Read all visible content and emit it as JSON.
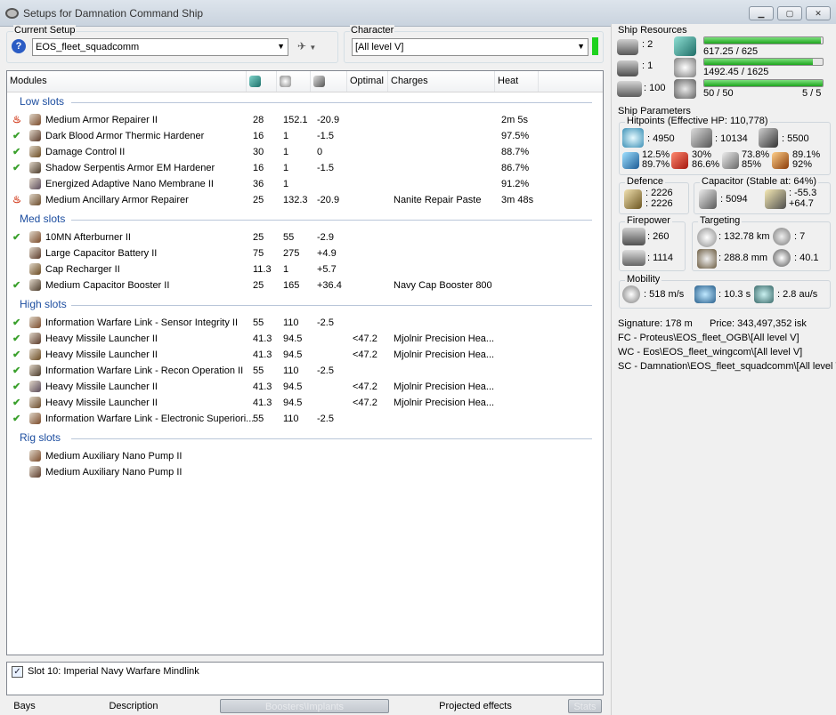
{
  "window": {
    "title": "Setups for Damnation Command Ship"
  },
  "setup": {
    "label": "Current Setup",
    "value": "EOS_fleet_squadcomm"
  },
  "character": {
    "label": "Character",
    "value": "[All level V]"
  },
  "columns": {
    "modules": "Modules",
    "optimal": "Optimal",
    "charges": "Charges",
    "heat": "Heat"
  },
  "low": {
    "title": "Low slots",
    "rows": [
      {
        "name": "Medium Armor Repairer II",
        "a": "28",
        "b": "152.1",
        "c": "-20.9",
        "opt": "",
        "charge": "",
        "heat": "2m 5s"
      },
      {
        "name": "Dark Blood Armor Thermic Hardener",
        "a": "16",
        "b": "1",
        "c": "-1.5",
        "opt": "",
        "charge": "",
        "heat": "97.5%"
      },
      {
        "name": "Damage Control II",
        "a": "30",
        "b": "1",
        "c": "0",
        "opt": "",
        "charge": "",
        "heat": "88.7%"
      },
      {
        "name": "Shadow Serpentis Armor EM Hardener",
        "a": "16",
        "b": "1",
        "c": "-1.5",
        "opt": "",
        "charge": "",
        "heat": "86.7%"
      },
      {
        "name": "Energized Adaptive Nano Membrane II",
        "a": "36",
        "b": "1",
        "c": "",
        "opt": "",
        "charge": "",
        "heat": "91.2%"
      },
      {
        "name": "Medium Ancillary Armor Repairer",
        "a": "25",
        "b": "132.3",
        "c": "-20.9",
        "opt": "",
        "charge": "Nanite Repair Paste",
        "heat": "3m 48s"
      }
    ]
  },
  "med": {
    "title": "Med slots",
    "rows": [
      {
        "name": "10MN Afterburner II",
        "a": "25",
        "b": "55",
        "c": "-2.9",
        "opt": "",
        "charge": "",
        "heat": ""
      },
      {
        "name": "Large Capacitor Battery II",
        "a": "75",
        "b": "275",
        "c": "+4.9",
        "opt": "",
        "charge": "",
        "heat": ""
      },
      {
        "name": "Cap Recharger II",
        "a": "11.3",
        "b": "1",
        "c": "+5.7",
        "opt": "",
        "charge": "",
        "heat": ""
      },
      {
        "name": "Medium Capacitor Booster II",
        "a": "25",
        "b": "165",
        "c": "+36.4",
        "opt": "",
        "charge": "Navy Cap Booster 800",
        "heat": ""
      }
    ]
  },
  "high": {
    "title": "High slots",
    "rows": [
      {
        "name": "Information Warfare Link - Sensor Integrity II",
        "a": "55",
        "b": "110",
        "c": "-2.5",
        "opt": "",
        "charge": "",
        "heat": ""
      },
      {
        "name": "Heavy Missile Launcher II",
        "a": "41.3",
        "b": "94.5",
        "c": "",
        "opt": "<47.2",
        "charge": "Mjolnir Precision Hea...",
        "heat": ""
      },
      {
        "name": "Heavy Missile Launcher II",
        "a": "41.3",
        "b": "94.5",
        "c": "",
        "opt": "<47.2",
        "charge": "Mjolnir Precision Hea...",
        "heat": ""
      },
      {
        "name": "Information Warfare Link - Recon Operation II",
        "a": "55",
        "b": "110",
        "c": "-2.5",
        "opt": "",
        "charge": "",
        "heat": ""
      },
      {
        "name": "Heavy Missile Launcher II",
        "a": "41.3",
        "b": "94.5",
        "c": "",
        "opt": "<47.2",
        "charge": "Mjolnir Precision Hea...",
        "heat": ""
      },
      {
        "name": "Heavy Missile Launcher II",
        "a": "41.3",
        "b": "94.5",
        "c": "",
        "opt": "<47.2",
        "charge": "Mjolnir Precision Hea...",
        "heat": ""
      },
      {
        "name": "Information Warfare Link - Electronic Superiori...",
        "a": "55",
        "b": "110",
        "c": "-2.5",
        "opt": "",
        "charge": "",
        "heat": ""
      }
    ]
  },
  "rig": {
    "title": "Rig slots",
    "rows": [
      {
        "name": "Medium Auxiliary Nano Pump II"
      },
      {
        "name": "Medium Auxiliary Nano Pump II"
      }
    ]
  },
  "implant": {
    "text": "Slot 10: Imperial Navy Warfare Mindlink"
  },
  "tabs": [
    "Bays",
    "Description",
    "Boosters\\Implants",
    "Projected effects",
    "Stats"
  ],
  "resources": {
    "title": "Ship Resources",
    "turrets": ": 2",
    "launchers": ": 1",
    "drones": ": 100",
    "cpu": "617.25 / 625",
    "power": "1492.45 / 1625",
    "calibration": "50 / 50",
    "rigs": "5 / 5",
    "cpu_frac": 0.988,
    "power_frac": 0.918,
    "cal_frac": 1.0
  },
  "params": {
    "title": "Ship Parameters",
    "hp_label": "Hitpoints (Effective HP: 110,778)",
    "shield_hp": ": 4950",
    "armor_hp": ": 10134",
    "hull_hp": ": 5500",
    "res": {
      "em1": "12.5%",
      "em2": "89.7%",
      "th1": "30%",
      "th2": "86.6%",
      "ki1": "73.8%",
      "ki2": "85%",
      "ex1": "89.1%",
      "ex2": "92%"
    },
    "defence_label": "Defence",
    "def1": ": 2226",
    "def2": ": 2226",
    "cap_label": "Capacitor (Stable at: 64%)",
    "cap_val": ": 5094",
    "cap_d1": ": -55.3",
    "cap_d2": "+64.7",
    "fp_label": "Firepower",
    "fp1": ": 260",
    "fp2": ": 1114",
    "tg_label": "Targeting",
    "tg1": ": 132.78 km",
    "tg2": ": 7",
    "tg3": ": 288.8 mm",
    "tg4": ": 40.1",
    "mob_label": "Mobility",
    "mob1": ": 518 m/s",
    "mob2": ": 10.3 s",
    "mob3": ": 2.8 au/s"
  },
  "summary": {
    "signature": "Signature: 178 m",
    "price": "Price: 343,497,352 isk",
    "fc": "FC - Proteus\\EOS_fleet_OGB\\[All level V]",
    "wc": "WC - Eos\\EOS_fleet_wingcom\\[All level V]",
    "sc": "SC - Damnation\\EOS_fleet_squadcomm\\[All level V]"
  },
  "colors": {
    "slot_title": "#1d4ea0",
    "bar_fill": "#1ea51e",
    "check": "#3aa02c"
  }
}
